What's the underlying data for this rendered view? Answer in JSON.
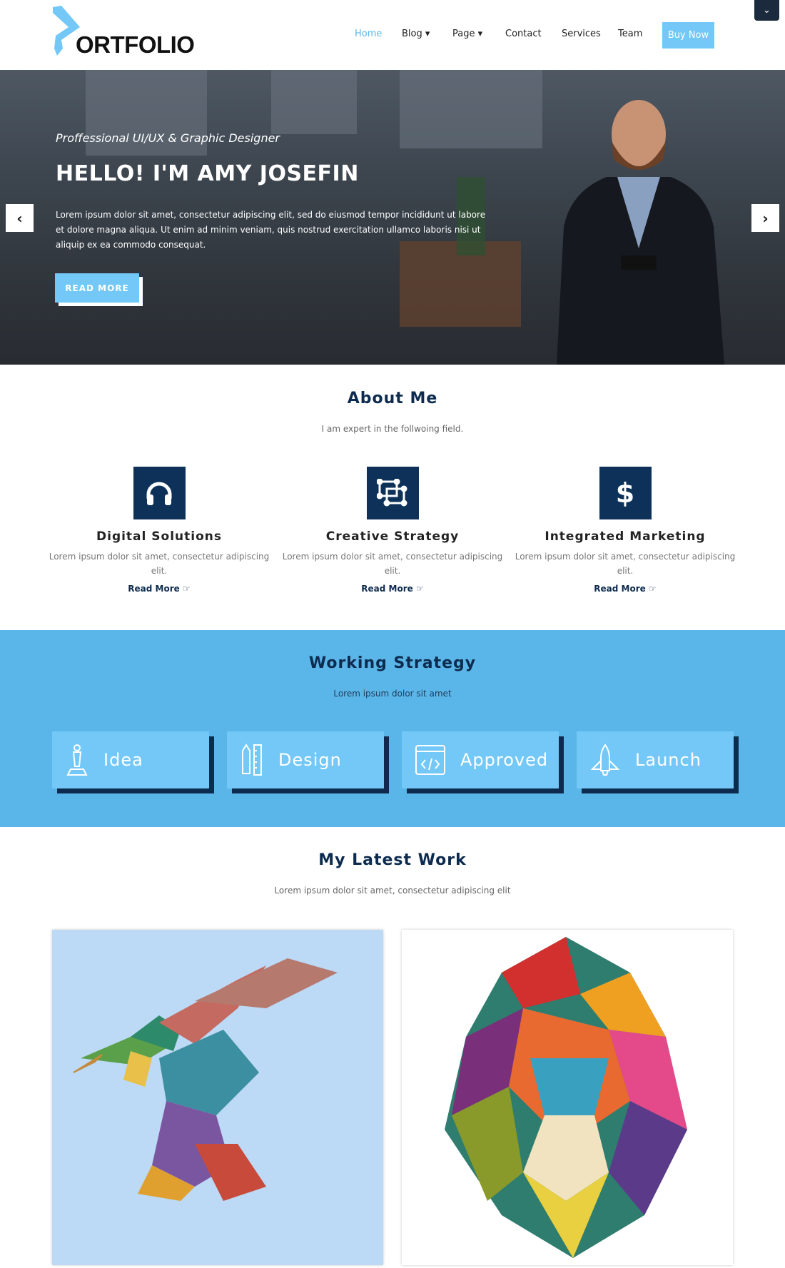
{
  "header": {
    "logo_text": "ORTFOLIO",
    "nav": [
      "Home",
      "Blog",
      "Page",
      "Contact",
      "Services",
      "Team"
    ],
    "buy_now": "Buy Now",
    "scroll_toggle_icon": "chevron-down-icon"
  },
  "hero": {
    "subtitle": "Proffessional UI/UX & Graphic Designer",
    "title": "HELLO! I'M AMY JOSEFIN",
    "text": "Lorem ipsum dolor sit amet, consectetur adipiscing elit, sed do eiusmod tempor incididunt ut labore et dolore magna aliqua. Ut enim ad minim veniam, quis nostrud exercitation ullamco laboris nisi ut aliquip ex ea commodo consequat.",
    "button": "READ MORE",
    "prev_icon": "chevron-left-icon",
    "next_icon": "chevron-right-icon"
  },
  "about": {
    "title": "About Me",
    "subtitle": "I am expert in the follwoing field.",
    "cards": [
      {
        "icon": "headphones-icon",
        "title": "Digital Solutions",
        "text": "Lorem ipsum dolor sit amet, consectetur adipiscing elit.",
        "link": "Read More"
      },
      {
        "icon": "vector-shapes-icon",
        "title": "Creative Strategy",
        "text": "Lorem ipsum dolor sit amet, consectetur adipiscing elit.",
        "link": "Read More"
      },
      {
        "icon": "dollar-icon",
        "title": "Integrated Marketing",
        "text": "Lorem ipsum dolor sit amet, consectetur adipiscing elit.",
        "link": "Read More"
      }
    ]
  },
  "strategy": {
    "title": "Working Strategy",
    "subtitle": "Lorem ipsum dolor sit amet",
    "steps": [
      {
        "icon": "chess-pawn-icon",
        "label": "Idea"
      },
      {
        "icon": "pencil-ruler-icon",
        "label": "Design"
      },
      {
        "icon": "code-window-icon",
        "label": "Approved"
      },
      {
        "icon": "rocket-icon",
        "label": "Launch"
      }
    ]
  },
  "work": {
    "title": "My Latest Work",
    "subtitle": "Lorem ipsum dolor sit amet, consectetur adipiscing elit"
  },
  "colors": {
    "accent": "#73c8f7",
    "navy": "#0d2b4e",
    "strategy_bg": "#5ab6e8"
  }
}
